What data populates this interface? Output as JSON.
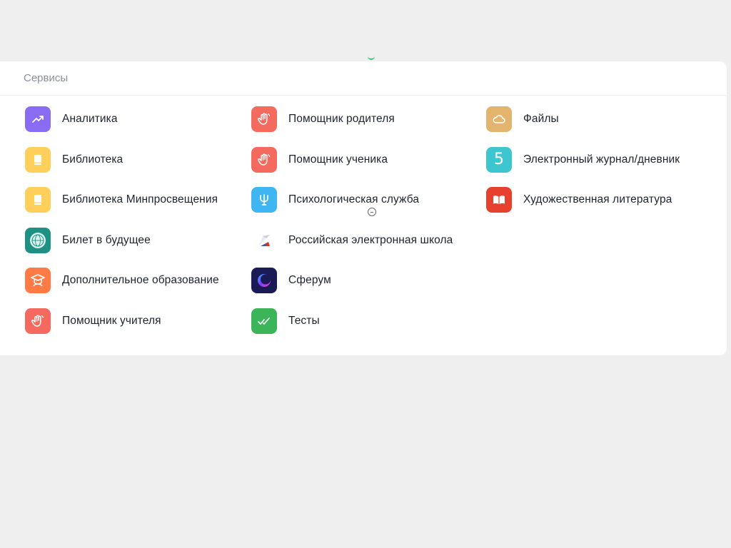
{
  "section": {
    "title": "Сервисы"
  },
  "columns": [
    [
      {
        "label": "Аналитика",
        "icon": "chart-trend-icon",
        "color": "#8a6cf2"
      },
      {
        "label": "Библиотека",
        "icon": "book-icon",
        "color": "#ffcf5c"
      },
      {
        "label": "Библиотека Минпросвещения",
        "icon": "book-icon",
        "color": "#ffcf5c"
      },
      {
        "label": "Билет в будущее",
        "icon": "globe-emblem-icon",
        "color": "#1f9184"
      },
      {
        "label": "Дополнительное образование",
        "icon": "graduate-icon",
        "color": "#ff7a45"
      },
      {
        "label": "Помощник учителя",
        "icon": "hand-wave-icon",
        "color": "#f46a5e"
      }
    ],
    [
      {
        "label": "Помощник родителя",
        "icon": "hand-wave-icon",
        "color": "#f46a5e"
      },
      {
        "label": "Помощник ученика",
        "icon": "hand-wave-icon",
        "color": "#f46a5e"
      },
      {
        "label": "Психологическая служба",
        "icon": "psi-icon",
        "color": "#3fb5f2"
      },
      {
        "label": "Российская электронная школа",
        "icon": "resh-logo-icon",
        "color": "#ffffff"
      },
      {
        "label": "Сферум",
        "icon": "sferum-logo-icon",
        "color": "#1a1a55"
      },
      {
        "label": "Тесты",
        "icon": "check-double-icon",
        "color": "#3cb55a"
      }
    ],
    [
      {
        "label": "Файлы",
        "icon": "cloud-icon",
        "color": "#e2b46d"
      },
      {
        "label": "Электронный журнал/дневник",
        "icon": "digit-five-icon",
        "color": "#3dc6d0",
        "glyph": "5"
      },
      {
        "label": "Художественная литература",
        "icon": "open-book-icon",
        "color": "#e8402f"
      }
    ]
  ]
}
